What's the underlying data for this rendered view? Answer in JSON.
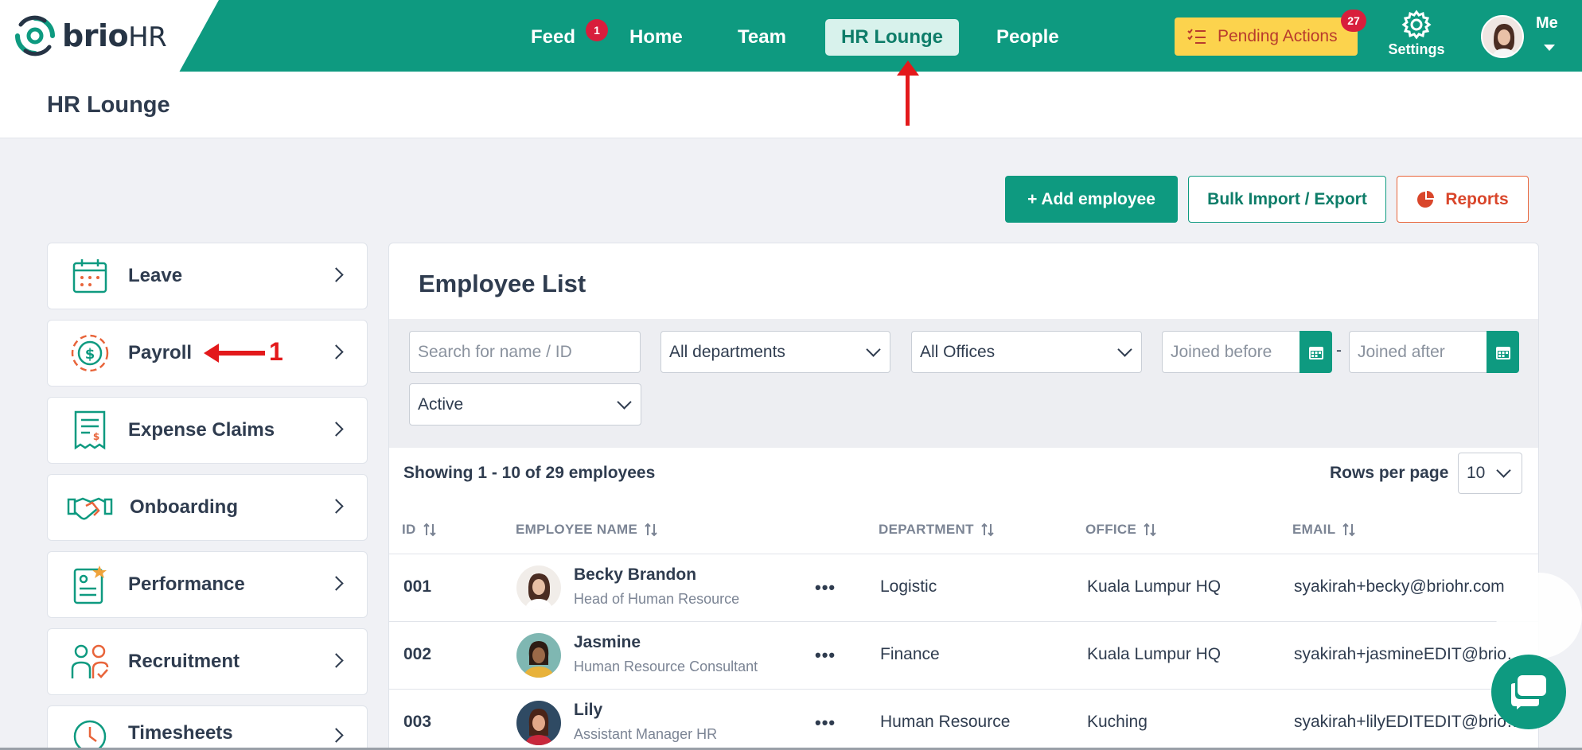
{
  "brand": {
    "name_a": "brio",
    "name_b": "HR"
  },
  "nav": {
    "items": [
      {
        "label": "Feed",
        "badge": "1"
      },
      {
        "label": "Home"
      },
      {
        "label": "Team"
      },
      {
        "label": "HR Lounge",
        "active": true
      },
      {
        "label": "People"
      }
    ],
    "pending": {
      "label": "Pending Actions",
      "badge": "27"
    },
    "settings_label": "Settings",
    "me_label": "Me"
  },
  "page": {
    "title": "HR Lounge"
  },
  "actions": {
    "add_employee": "+ Add employee",
    "bulk": "Bulk Import / Export",
    "reports": "Reports"
  },
  "annotation": {
    "payroll_marker": "1"
  },
  "sidebar": {
    "items": [
      {
        "label": "Leave",
        "icon": "calendar-icon"
      },
      {
        "label": "Payroll",
        "icon": "dollar-coin-icon"
      },
      {
        "label": "Expense Claims",
        "icon": "receipt-icon"
      },
      {
        "label": "Onboarding",
        "icon": "handshake-icon"
      },
      {
        "label": "Performance",
        "icon": "performance-star-icon"
      },
      {
        "label": "Recruitment",
        "icon": "people-check-icon"
      },
      {
        "label": "Timesheets",
        "icon": "clock-icon"
      }
    ]
  },
  "employee_list": {
    "title": "Employee List",
    "filters": {
      "search_placeholder": "Search for name / ID",
      "department": "All departments",
      "office": "All Offices",
      "joined_before_placeholder": "Joined before",
      "joined_after_placeholder": "Joined after",
      "range_separator": "-",
      "status": "Active"
    },
    "showing": "Showing 1 - 10 of 29 employees",
    "rows_per_page_label": "Rows per page",
    "rows_per_page_value": "10",
    "columns": [
      "ID",
      "EMPLOYEE NAME",
      "DEPARTMENT",
      "OFFICE",
      "EMAIL"
    ],
    "rows": [
      {
        "id": "001",
        "name": "Becky Brandon",
        "role": "Head of Human Resource",
        "department": "Logistic",
        "office": "Kuala Lumpur HQ",
        "email": "syakirah+becky@briohr.com"
      },
      {
        "id": "002",
        "name": "Jasmine",
        "role": "Human Resource Consultant",
        "department": "Finance",
        "office": "Kuala Lumpur HQ",
        "email": "syakirah+jasmineEDIT@briohr.com"
      },
      {
        "id": "003",
        "name": "Lily",
        "role": "Assistant Manager HR",
        "department": "Human Resource",
        "office": "Kuching",
        "email": "syakirah+lilyEDITEDIT@briohr.com"
      }
    ],
    "row_menu": "•••"
  },
  "colors": {
    "brand": "#0e9a80",
    "pending": "#fcd34d",
    "badge": "#d81e3c",
    "reports": "#d9462b",
    "annotation": "#e3191b"
  }
}
